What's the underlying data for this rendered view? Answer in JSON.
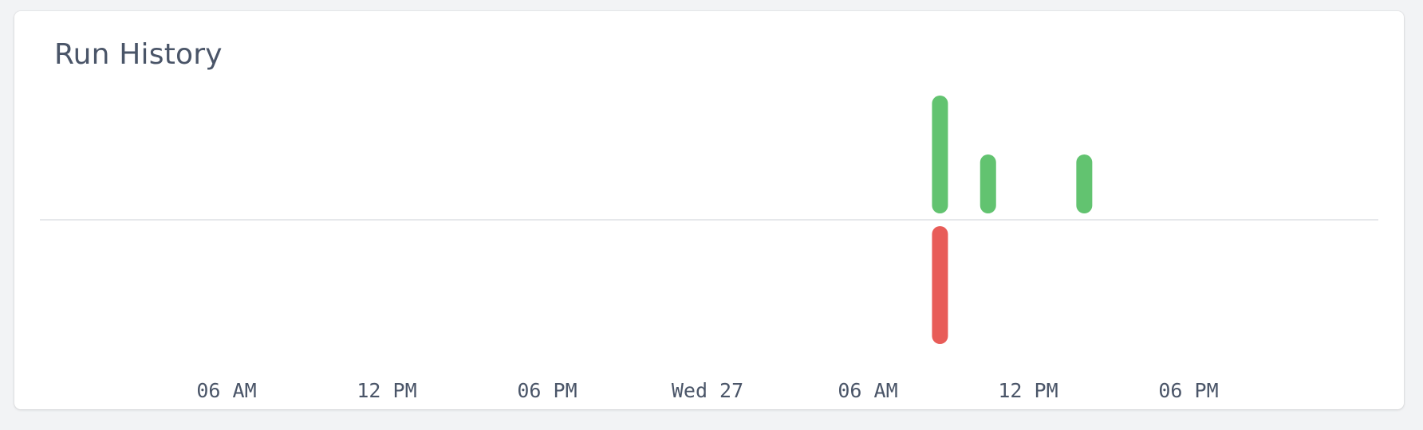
{
  "card": {
    "title": "Run History"
  },
  "chart_data": {
    "type": "bar",
    "title": "Run History",
    "x_ticks": [
      "06 AM",
      "12 PM",
      "06 PM",
      "Wed 27",
      "06 AM",
      "12 PM",
      "06 PM"
    ],
    "series": [
      {
        "status": "success",
        "color": "#62c370",
        "bars": [
          {
            "tick_position": 4.45,
            "value": 2
          },
          {
            "tick_position": 4.75,
            "value": 1
          },
          {
            "tick_position": 5.35,
            "value": 1
          }
        ]
      },
      {
        "status": "failure",
        "color": "#e85c58",
        "bars": [
          {
            "tick_position": 4.45,
            "value": -2
          }
        ]
      }
    ],
    "ylim": [
      -2,
      2
    ],
    "grid": false,
    "baseline": true
  }
}
